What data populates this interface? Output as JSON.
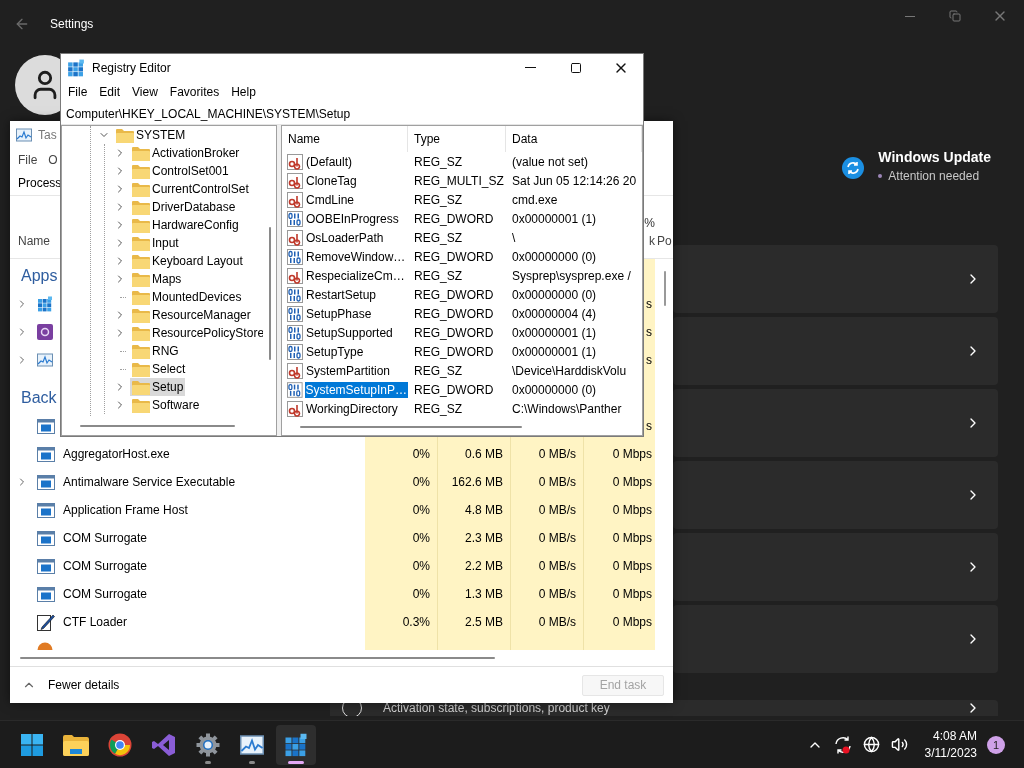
{
  "settings": {
    "title": "Settings",
    "update": {
      "title": "Windows Update",
      "status": "Attention needed"
    },
    "cards": [
      {
        "kind": "link"
      },
      {
        "kind": "link"
      },
      {
        "kind": "link"
      },
      {
        "kind": "link"
      },
      {
        "kind": "link"
      },
      {
        "kind": "link"
      },
      {
        "kind": "link",
        "caption": "Activation state, subscriptions, product key"
      }
    ]
  },
  "task_manager": {
    "title": "Tas",
    "menu": [
      "File",
      "O"
    ],
    "tab": "Process",
    "headers": {
      "name": "Name",
      "network_top": "%",
      "network": "k",
      "power": "Po"
    },
    "groups": [
      {
        "title": "Apps",
        "rows": [
          {
            "kind": "registry",
            "expandable": true,
            "network": "s"
          },
          {
            "kind": "media",
            "expandable": true,
            "network": "s"
          },
          {
            "kind": "monitor",
            "expandable": true,
            "network": "s"
          }
        ]
      },
      {
        "title": "Back",
        "rows": [
          {
            "kind": "service",
            "expandable": false,
            "network": "s"
          },
          {
            "kind": "service",
            "expandable": false,
            "name": "AggregatorHost.exe",
            "cpu": "0%",
            "memory": "0.6 MB",
            "disk": "0 MB/s",
            "network": "0 Mbps"
          },
          {
            "kind": "service",
            "expandable": true,
            "name": "Antimalware Service Executable",
            "cpu": "0%",
            "memory": "162.6 MB",
            "disk": "0 MB/s",
            "network": "0 Mbps"
          },
          {
            "kind": "service",
            "expandable": false,
            "name": "Application Frame Host",
            "cpu": "0%",
            "memory": "4.8 MB",
            "disk": "0 MB/s",
            "network": "0 Mbps"
          },
          {
            "kind": "service",
            "expandable": false,
            "name": "COM Surrogate",
            "cpu": "0%",
            "memory": "2.3 MB",
            "disk": "0 MB/s",
            "network": "0 Mbps"
          },
          {
            "kind": "service",
            "expandable": false,
            "name": "COM Surrogate",
            "cpu": "0%",
            "memory": "2.2 MB",
            "disk": "0 MB/s",
            "network": "0 Mbps"
          },
          {
            "kind": "service",
            "expandable": false,
            "name": "COM Surrogate",
            "cpu": "0%",
            "memory": "1.3 MB",
            "disk": "0 MB/s",
            "network": "0 Mbps"
          },
          {
            "kind": "editor",
            "expandable": false,
            "name": "CTF Loader",
            "cpu": "0.3%",
            "memory": "2.5 MB",
            "disk": "0 MB/s",
            "network": "0 Mbps"
          },
          {
            "kind": "partial",
            "expandable": false
          }
        ]
      }
    ],
    "footer": {
      "toggle": "Fewer details",
      "end_task": {
        "label": "End task",
        "disabled": true
      }
    }
  },
  "registry_editor": {
    "title": "Registry Editor",
    "menu": [
      "File",
      "Edit",
      "View",
      "Favorites",
      "Help"
    ],
    "address": "Computer\\HKEY_LOCAL_MACHINE\\SYSTEM\\Setup",
    "tree": [
      {
        "name": "SYSTEM",
        "expandable": true,
        "expanded": true,
        "selected": false,
        "children": [
          {
            "name": "ActivationBroker",
            "expandable": true,
            "selected": false
          },
          {
            "name": "ControlSet001",
            "expandable": true,
            "selected": false
          },
          {
            "name": "CurrentControlSet",
            "expandable": true,
            "selected": false
          },
          {
            "name": "DriverDatabase",
            "expandable": true,
            "selected": false
          },
          {
            "name": "HardwareConfig",
            "expandable": true,
            "selected": false
          },
          {
            "name": "Input",
            "expandable": true,
            "selected": false
          },
          {
            "name": "Keyboard Layout",
            "expandable": true,
            "selected": false
          },
          {
            "name": "Maps",
            "expandable": true,
            "selected": false
          },
          {
            "name": "MountedDevices",
            "expandable": false,
            "selected": false
          },
          {
            "name": "ResourceManager",
            "expandable": true,
            "selected": false
          },
          {
            "name": "ResourcePolicyStore",
            "expandable": true,
            "selected": false
          },
          {
            "name": "RNG",
            "expandable": false,
            "selected": false
          },
          {
            "name": "Select",
            "expandable": false,
            "selected": false
          },
          {
            "name": "Setup",
            "expandable": true,
            "selected": true
          },
          {
            "name": "Software",
            "expandable": true,
            "selected": false
          }
        ]
      }
    ],
    "columns": [
      "Name",
      "Type",
      "Data"
    ],
    "values": [
      {
        "kind": "string",
        "name": "(Default)",
        "type": "REG_SZ",
        "data": "(value not set)",
        "selected": false
      },
      {
        "kind": "string",
        "name": "CloneTag",
        "type": "REG_MULTI_SZ",
        "data": "Sat Jun 05 12:14:26 20",
        "selected": false
      },
      {
        "kind": "string",
        "name": "CmdLine",
        "type": "REG_SZ",
        "data": "cmd.exe",
        "selected": false
      },
      {
        "kind": "number",
        "name": "OOBEInProgress",
        "type": "REG_DWORD",
        "data": "0x00000001 (1)",
        "selected": false
      },
      {
        "kind": "string",
        "name": "OsLoaderPath",
        "type": "REG_SZ",
        "data": "\\",
        "selected": false
      },
      {
        "kind": "number",
        "name": "RemoveWindow…",
        "type": "REG_DWORD",
        "data": "0x00000000 (0)",
        "selected": false
      },
      {
        "kind": "string",
        "name": "RespecializeCm…",
        "type": "REG_SZ",
        "data": "Sysprep\\sysprep.exe /",
        "selected": false
      },
      {
        "kind": "number",
        "name": "RestartSetup",
        "type": "REG_DWORD",
        "data": "0x00000000 (0)",
        "selected": false
      },
      {
        "kind": "number",
        "name": "SetupPhase",
        "type": "REG_DWORD",
        "data": "0x00000004 (4)",
        "selected": false
      },
      {
        "kind": "number",
        "name": "SetupSupported",
        "type": "REG_DWORD",
        "data": "0x00000001 (1)",
        "selected": false
      },
      {
        "kind": "number",
        "name": "SetupType",
        "type": "REG_DWORD",
        "data": "0x00000001 (1)",
        "selected": false
      },
      {
        "kind": "string",
        "name": "SystemPartition",
        "type": "REG_SZ",
        "data": "\\Device\\HarddiskVolu",
        "selected": false
      },
      {
        "kind": "number",
        "name": "SystemSetupInP…",
        "type": "REG_DWORD",
        "data": "0x00000000 (0)",
        "selected": true
      },
      {
        "kind": "string",
        "name": "WorkingDirectory",
        "type": "REG_SZ",
        "data": "C:\\Windows\\Panther",
        "selected": false
      }
    ]
  },
  "taskbar": {
    "apps": [
      {
        "kind": "start",
        "running": false,
        "active": false
      },
      {
        "kind": "explorer",
        "running": false,
        "active": false
      },
      {
        "kind": "chrome",
        "running": false,
        "active": false
      },
      {
        "kind": "studio",
        "running": false,
        "active": false
      },
      {
        "kind": "settings",
        "running": true,
        "active": false
      },
      {
        "kind": "monitor",
        "running": true,
        "active": false
      },
      {
        "kind": "registry",
        "running": true,
        "active": true
      }
    ],
    "tray": {
      "time": "4:08 AM",
      "date": "3/11/2023",
      "badge": "1"
    }
  }
}
